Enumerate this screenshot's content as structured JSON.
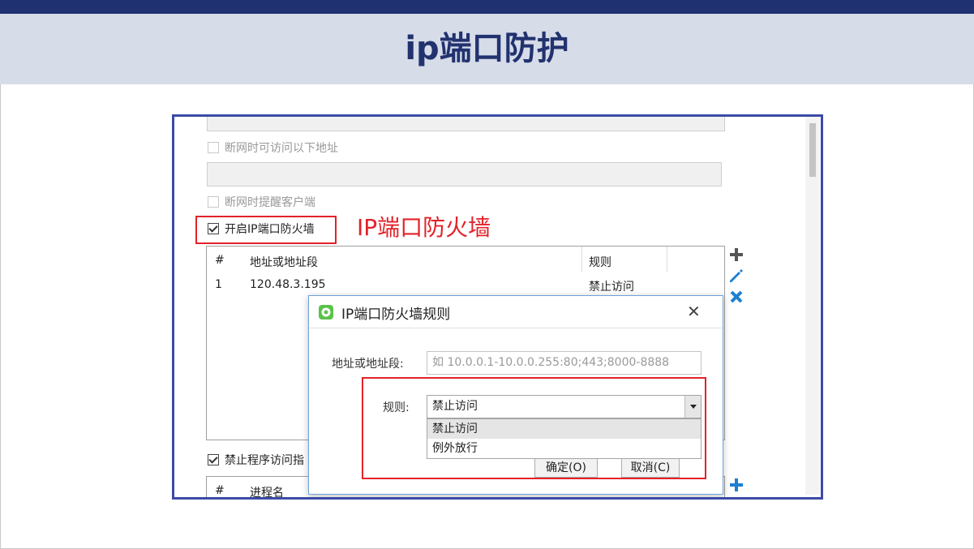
{
  "slide": {
    "title": "ip端口防护"
  },
  "callout": "IP端口防火墙",
  "settings": {
    "offline_access_label": "断网时可访问以下地址",
    "offline_remind_label": "断网时提醒客户端",
    "enable_firewall_label": "开启IP端口防火墙",
    "block_program_label": "禁止程序访问指"
  },
  "firewall_table": {
    "headers": [
      "#",
      "地址或地址段",
      "规则"
    ],
    "rows": [
      {
        "num": "1",
        "address": "120.48.3.195",
        "rule": "禁止访问"
      }
    ]
  },
  "process_table": {
    "headers": [
      "#",
      "进程名"
    ]
  },
  "dialog": {
    "title": "IP端口防火墙规则",
    "address_label": "地址或地址段:",
    "address_placeholder": "如 10.0.0.1-10.0.0.255:80;443;8000-8888",
    "rule_label": "规则:",
    "rule_selected": "禁止访问",
    "rule_options": [
      "禁止访问",
      "例外放行"
    ],
    "ok_label": "确定(O)",
    "cancel_label": "取消(C)"
  },
  "icons": {
    "add": "plus-icon",
    "edit": "pencil-icon",
    "delete": "x-icon",
    "dialog_app": "app-icon"
  },
  "colors": {
    "accent_navy": "#1f3170",
    "highlight_red": "#e2222a",
    "icon_blue": "#1d7fd1"
  }
}
